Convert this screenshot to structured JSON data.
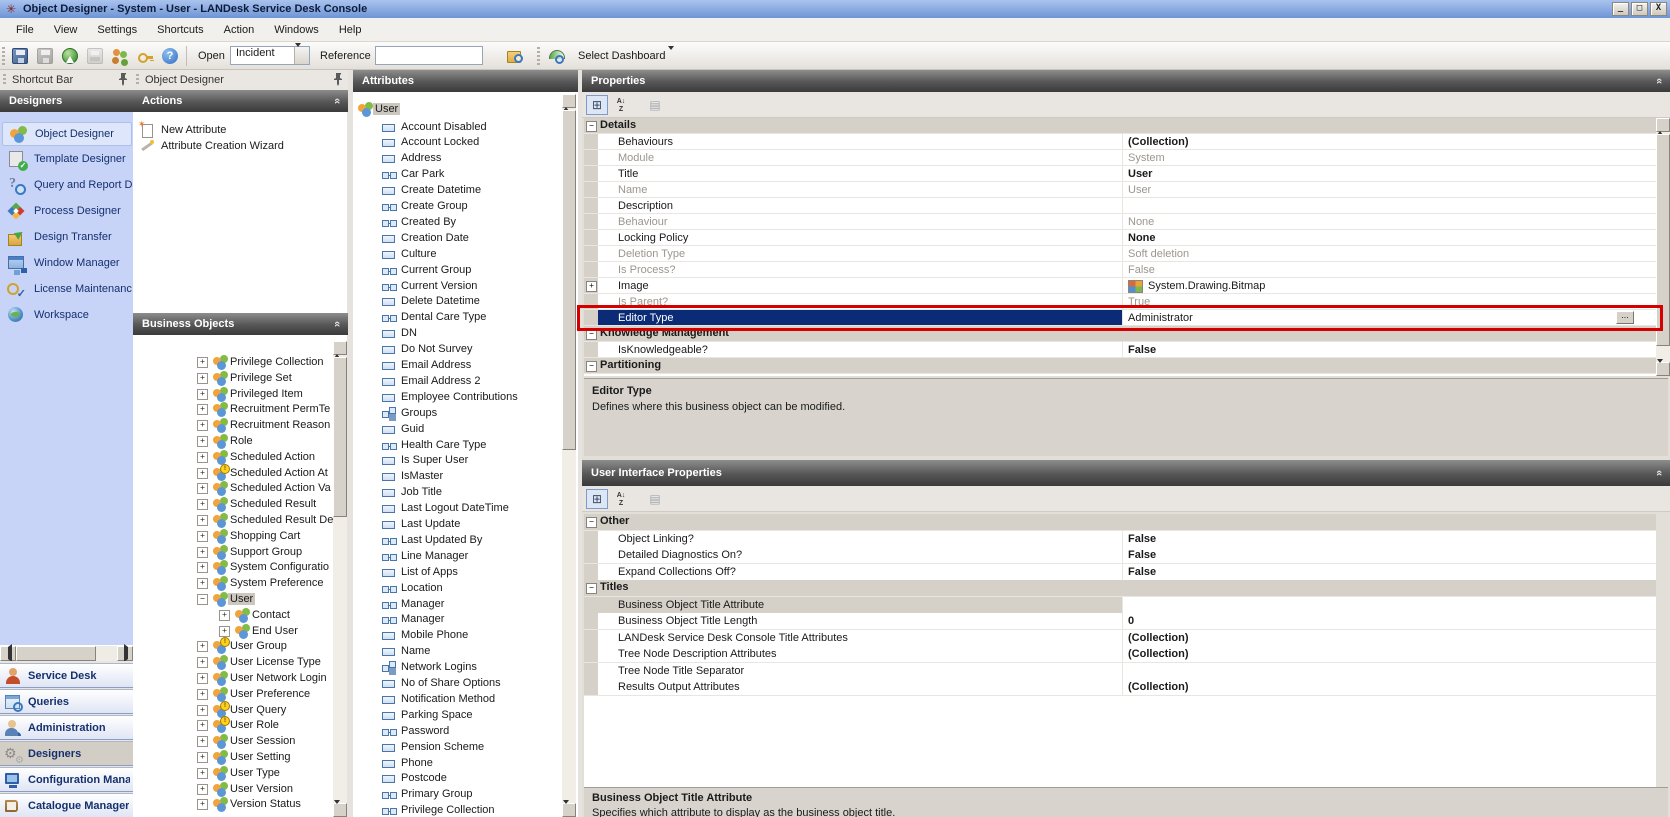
{
  "window": {
    "title": "Object Designer - System - User - LANDesk Service Desk Console",
    "controls": [
      "minimize",
      "restore",
      "close"
    ]
  },
  "menu": {
    "items": [
      "File",
      "View",
      "Settings",
      "Shortcuts",
      "Action",
      "Windows",
      "Help"
    ]
  },
  "toolbar": {
    "buttons": [
      {
        "name": "save",
        "enabled": true
      },
      {
        "name": "save-as",
        "enabled": false
      },
      {
        "name": "home",
        "enabled": true
      },
      {
        "name": "print",
        "enabled": false
      },
      {
        "name": "users",
        "enabled": true
      },
      {
        "name": "key",
        "enabled": true
      },
      {
        "name": "help",
        "enabled": true
      }
    ],
    "open_label": "Open",
    "open_value": "Incident",
    "reference_label": "Reference",
    "reference_value": "",
    "search_icon": "folder-search",
    "dashboard_icon": "dashboard-gauge",
    "dashboard_label": "Select Dashboard"
  },
  "shortcut_bar": {
    "caption": "Shortcut Bar",
    "section": "Designers",
    "items": [
      {
        "label": "Object Designer",
        "icon": "object-designer",
        "selected": true
      },
      {
        "label": "Template Designer",
        "icon": "template-designer"
      },
      {
        "label": "Query and Report D",
        "icon": "query-report"
      },
      {
        "label": "Process Designer",
        "icon": "process-designer"
      },
      {
        "label": "Design Transfer",
        "icon": "design-transfer"
      },
      {
        "label": "Window Manager",
        "icon": "window-manager"
      },
      {
        "label": "License Maintenanc",
        "icon": "license-maintenance"
      },
      {
        "label": "Workspace",
        "icon": "workspace"
      }
    ],
    "groups": [
      {
        "label": "Service Desk",
        "icon": "service-desk"
      },
      {
        "label": "Queries",
        "icon": "queries"
      },
      {
        "label": "Administration",
        "icon": "administration"
      },
      {
        "label": "Designers",
        "icon": "designers",
        "selected": true
      },
      {
        "label": "Configuration Mana",
        "icon": "configuration-manager"
      },
      {
        "label": "Catalogue Manager",
        "icon": "catalogue-manager"
      }
    ]
  },
  "object_designer_panel": {
    "caption": "Object Designer",
    "actions": {
      "header": "Actions",
      "items": [
        {
          "label": "New Attribute",
          "icon": "new-attribute"
        },
        {
          "label": "Attribute Creation Wizard",
          "icon": "attribute-wizard"
        }
      ]
    },
    "business_objects": {
      "header": "Business Objects",
      "items": [
        {
          "label": "Privilege Collection",
          "level": 0,
          "expander": "plus"
        },
        {
          "label": "Privilege Set",
          "level": 0,
          "expander": "plus"
        },
        {
          "label": "Privileged Item",
          "level": 0,
          "expander": "plus"
        },
        {
          "label": "Recruitment PermTe",
          "level": 0,
          "expander": "plus"
        },
        {
          "label": "Recruitment Reason",
          "level": 0,
          "expander": "plus"
        },
        {
          "label": "Role",
          "level": 0,
          "expander": "plus"
        },
        {
          "label": "Scheduled Action",
          "level": 0,
          "expander": "plus"
        },
        {
          "label": "Scheduled Action At",
          "level": 0,
          "expander": "plus",
          "badge": true
        },
        {
          "label": "Scheduled Action Va",
          "level": 0,
          "expander": "plus"
        },
        {
          "label": "Scheduled Result",
          "level": 0,
          "expander": "plus"
        },
        {
          "label": "Scheduled Result De",
          "level": 0,
          "expander": "plus"
        },
        {
          "label": "Shopping Cart",
          "level": 0,
          "expander": "plus"
        },
        {
          "label": "Support Group",
          "level": 0,
          "expander": "plus"
        },
        {
          "label": "System Configuratio",
          "level": 0,
          "expander": "plus"
        },
        {
          "label": "System Preference",
          "level": 0,
          "expander": "plus"
        },
        {
          "label": "User",
          "level": 0,
          "expander": "minus",
          "selected": true
        },
        {
          "label": "Contact",
          "level": 1,
          "expander": "plus"
        },
        {
          "label": "End User",
          "level": 1,
          "expander": "plus"
        },
        {
          "label": "User Group",
          "level": 0,
          "expander": "plus",
          "badge": true
        },
        {
          "label": "User License Type",
          "level": 0,
          "expander": "plus"
        },
        {
          "label": "User Network Login",
          "level": 0,
          "expander": "plus"
        },
        {
          "label": "User Preference",
          "level": 0,
          "expander": "plus"
        },
        {
          "label": "User Query",
          "level": 0,
          "expander": "plus",
          "badge": true
        },
        {
          "label": "User Role",
          "level": 0,
          "expander": "plus",
          "badge": true
        },
        {
          "label": "User Session",
          "level": 0,
          "expander": "plus"
        },
        {
          "label": "User Setting",
          "level": 0,
          "expander": "plus"
        },
        {
          "label": "User Type",
          "level": 0,
          "expander": "plus"
        },
        {
          "label": "User Version",
          "level": 0,
          "expander": "plus"
        },
        {
          "label": "Version Status",
          "level": 0,
          "expander": "plus"
        }
      ]
    }
  },
  "attributes_panel": {
    "header": "Attributes",
    "root": {
      "label": "User",
      "icon": "business-object"
    },
    "items": [
      {
        "label": "Account Disabled",
        "icon": "field"
      },
      {
        "label": "Account Locked",
        "icon": "field"
      },
      {
        "label": "Address",
        "icon": "field"
      },
      {
        "label": "Car Park",
        "icon": "related"
      },
      {
        "label": "Create Datetime",
        "icon": "field"
      },
      {
        "label": "Create Group",
        "icon": "related"
      },
      {
        "label": "Created By",
        "icon": "related"
      },
      {
        "label": "Creation Date",
        "icon": "field"
      },
      {
        "label": "Culture",
        "icon": "field"
      },
      {
        "label": "Current Group",
        "icon": "related"
      },
      {
        "label": "Current Version",
        "icon": "related"
      },
      {
        "label": "Delete Datetime",
        "icon": "field"
      },
      {
        "label": "Dental Care Type",
        "icon": "related"
      },
      {
        "label": "DN",
        "icon": "field"
      },
      {
        "label": "Do Not Survey",
        "icon": "field"
      },
      {
        "label": "Email Address",
        "icon": "field"
      },
      {
        "label": "Email Address 2",
        "icon": "field"
      },
      {
        "label": "Employee Contributions",
        "icon": "field"
      },
      {
        "label": "Groups",
        "icon": "collection"
      },
      {
        "label": "Guid",
        "icon": "field"
      },
      {
        "label": "Health Care Type",
        "icon": "related"
      },
      {
        "label": "Is Super User",
        "icon": "field"
      },
      {
        "label": "IsMaster",
        "icon": "field"
      },
      {
        "label": "Job Title",
        "icon": "field"
      },
      {
        "label": "Last Logout DateTime",
        "icon": "field"
      },
      {
        "label": "Last Update",
        "icon": "field"
      },
      {
        "label": "Last Updated By",
        "icon": "related"
      },
      {
        "label": "Line Manager",
        "icon": "related"
      },
      {
        "label": "List of Apps",
        "icon": "field"
      },
      {
        "label": "Location",
        "icon": "related"
      },
      {
        "label": "Manager",
        "icon": "related"
      },
      {
        "label": "Manager",
        "icon": "related"
      },
      {
        "label": "Mobile Phone",
        "icon": "field"
      },
      {
        "label": "Name",
        "icon": "field"
      },
      {
        "label": "Network Logins",
        "icon": "collection"
      },
      {
        "label": "No of Share Options",
        "icon": "field"
      },
      {
        "label": "Notification Method",
        "icon": "field"
      },
      {
        "label": "Parking Space",
        "icon": "field"
      },
      {
        "label": "Password",
        "icon": "related"
      },
      {
        "label": "Pension Scheme",
        "icon": "field"
      },
      {
        "label": "Phone",
        "icon": "field"
      },
      {
        "label": "Postcode",
        "icon": "field"
      },
      {
        "label": "Primary Group",
        "icon": "related"
      },
      {
        "label": "Privilege Collection",
        "icon": "related"
      }
    ]
  },
  "properties_panel": {
    "header": "Properties",
    "toolbar": [
      {
        "name": "categorized",
        "pressed": true
      },
      {
        "name": "alphabetical"
      },
      {
        "name": "property-pages",
        "enabled": false
      }
    ],
    "rows": [
      {
        "type": "category",
        "label": "Details"
      },
      {
        "label": "Behaviours",
        "value": "(Collection)",
        "value_bold": true
      },
      {
        "label": "Module",
        "value": "System",
        "disabled": true
      },
      {
        "label": "Title",
        "value": "User",
        "value_bold": true
      },
      {
        "label": "Name",
        "value": "User",
        "disabled": true
      },
      {
        "label": "Description",
        "value": ""
      },
      {
        "label": "Behaviour",
        "value": "None",
        "disabled": true
      },
      {
        "label": "Locking Policy",
        "value": "None",
        "value_bold": true
      },
      {
        "label": "Deletion Type",
        "value": "Soft deletion",
        "disabled": true
      },
      {
        "label": "Is Process?",
        "value": "False",
        "disabled": true
      },
      {
        "label": "Image",
        "value": "System.Drawing.Bitmap",
        "expander": "plus",
        "value_icon": "bitmap-icon"
      },
      {
        "label": "Is Parent?",
        "value": "True",
        "disabled": true
      },
      {
        "label": "Editor Type",
        "value": "Administrator",
        "selected": true,
        "ellipsis_button": true,
        "annotated": true
      },
      {
        "type": "category",
        "label": "Knowledge Management"
      },
      {
        "label": "IsKnowledgeable?",
        "value": "False",
        "value_bold": true
      },
      {
        "type": "category",
        "label": "Partitioning"
      }
    ],
    "description": {
      "title": "Editor Type",
      "text": "Defines where this business object can be modified."
    },
    "annotation_color": "#d40000"
  },
  "ui_properties_panel": {
    "header": "User Interface Properties",
    "toolbar": [
      {
        "name": "categorized",
        "pressed": true
      },
      {
        "name": "alphabetical"
      },
      {
        "name": "property-pages",
        "enabled": false
      }
    ],
    "rows": [
      {
        "type": "category",
        "label": "Other"
      },
      {
        "label": "Object Linking?",
        "value": "False",
        "value_bold": true
      },
      {
        "label": "Detailed Diagnostics On?",
        "value": "False",
        "value_bold": true
      },
      {
        "label": "Expand Collections Off?",
        "value": "False",
        "value_bold": true
      },
      {
        "type": "category",
        "label": "Titles"
      },
      {
        "label": "Business Object Title Attribute",
        "value": "",
        "label_highlight": true
      },
      {
        "label": "Business Object Title Length",
        "value": "0",
        "value_bold": true
      },
      {
        "label": "LANDesk Service Desk Console Title Attributes",
        "value": "(Collection)",
        "value_bold": true
      },
      {
        "label": "Tree Node Description Attributes",
        "value": "(Collection)",
        "value_bold": true
      },
      {
        "label": "Tree Node Title Separator",
        "value": ""
      },
      {
        "label": "Results Output Attributes",
        "value": "(Collection)",
        "value_bold": true
      }
    ],
    "description": {
      "title": "Business Object Title Attribute",
      "text": "Specifies which attribute to display as the business object title."
    }
  },
  "colors": {
    "selection_navy": "#0b2b76",
    "annotation_red": "#d40000",
    "titlebar_blue": "#6d95d5",
    "shortcut_bg": "#c7d4f8"
  }
}
